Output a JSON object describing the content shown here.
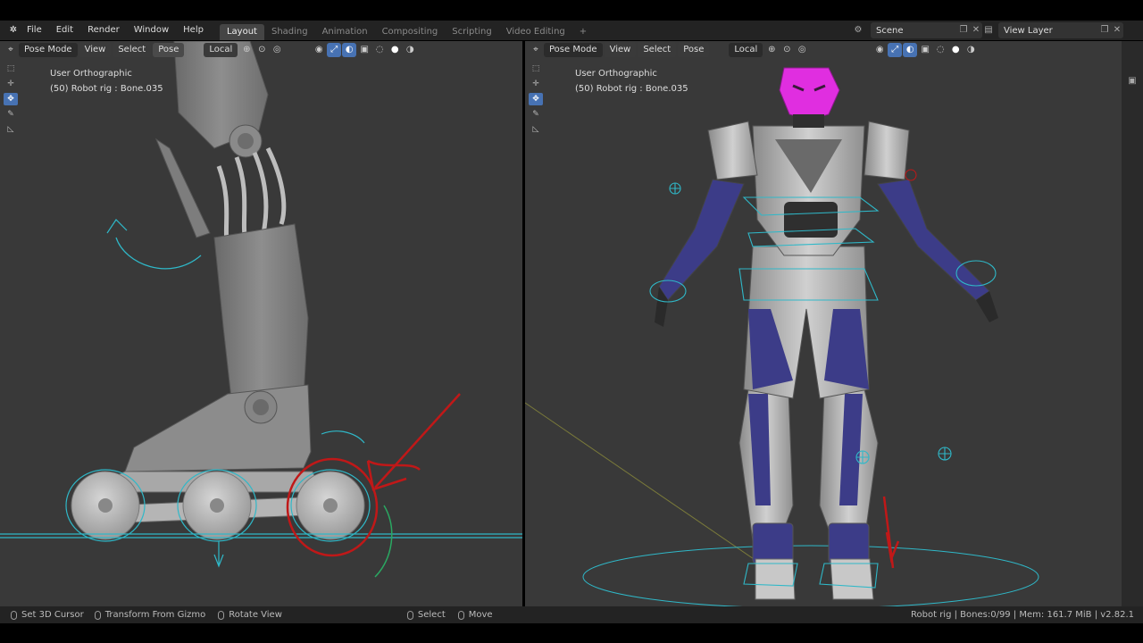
{
  "menubar": {
    "items": [
      "File",
      "Edit",
      "Render",
      "Window",
      "Help"
    ],
    "workspaces": [
      "Layout",
      "Shading",
      "Animation",
      "Compositing",
      "Scripting",
      "Video Editing"
    ],
    "active_workspace": "Layout",
    "add_tab": "+",
    "scene": "Scene",
    "view_layer": "View Layer"
  },
  "left_viewport": {
    "mode": "Pose Mode",
    "menus": [
      "View",
      "Select",
      "Pose"
    ],
    "orientation": "Local",
    "view_name": "User Orthographic",
    "object_info": "(50) Robot rig : Bone.035"
  },
  "right_viewport": {
    "mode": "Pose Mode",
    "menus": [
      "View",
      "Select",
      "Pose"
    ],
    "orientation": "Local",
    "view_name": "User Orthographic",
    "object_info": "(50) Robot rig : Bone.035"
  },
  "statusbar": {
    "items": [
      "Set 3D Cursor",
      "Transform From Gizmo",
      "Rotate View",
      "Select",
      "Move"
    ],
    "info": "Robot rig | Bones:0/99 | Mem: 161.7 MiB | v2.82.1"
  },
  "colors": {
    "accent": "#4772b3",
    "bone_highlight": "#e02ee0",
    "annotation": "#c01818",
    "rig_lines": "#2fb8c8",
    "armor_blue": "#3c3c88"
  },
  "icons": [
    "blender-logo-icon",
    "select-box-icon",
    "cursor-icon",
    "move-icon",
    "rotate-icon",
    "scale-icon",
    "annotate-icon",
    "measure-icon",
    "camera-icon"
  ]
}
